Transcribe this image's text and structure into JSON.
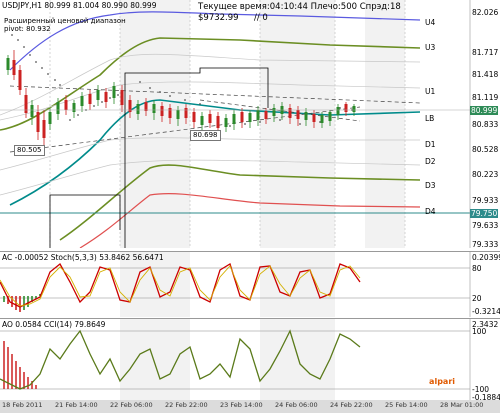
{
  "chart": {
    "symbol_header": "USDJPY,H1  80.999 81.004 80.990 80.999",
    "info_line1": "Текущее время:04:10:44 Плечо:500 Спрэд:18",
    "info_line2": "$9732.99",
    "info_line3": "// 0",
    "legend_line1": "Расширенный ценовой диапазон",
    "legend_line2": "pivot: 80.932",
    "price_label_left": "80.505",
    "price_label_mid": "80.698",
    "current_price": "80.999",
    "line_price": "79.750",
    "level_labels": [
      "U4",
      "U3",
      "U1",
      "LB",
      "D1",
      "D2",
      "D3",
      "D4"
    ],
    "level_colors": {
      "upper": "#6666dd",
      "mid": "#6b8e23",
      "lower": "#dd4444",
      "base": "#008b8b"
    }
  },
  "price_axis": [
    "82.026",
    "81.717",
    "81.418",
    "81.119",
    "80.999",
    "80.833",
    "80.528",
    "80.223",
    "79.933",
    "79.750",
    "79.633",
    "79.333"
  ],
  "stoch_panel": {
    "header": "AC -0.00052  Stoch(5,3,3) 53.8462  56.6471",
    "axis": [
      "0.20399",
      "80",
      "20",
      "-0.32142"
    ]
  },
  "ao_panel": {
    "header": "AO 0.0584  CCI(14) 79.8649",
    "axis": [
      "2.3432",
      "100",
      "-100",
      "-0.1884"
    ]
  },
  "time_axis": [
    "18 Feb 2011",
    "21 Feb 14:00",
    "22 Feb 06:00",
    "22 Feb 22:00",
    "23 Feb 14:00",
    "24 Feb 06:00",
    "24 Feb 22:00",
    "25 Feb 14:00",
    "28 Mar 01:00"
  ],
  "branding": {
    "logo": "alpari"
  }
}
